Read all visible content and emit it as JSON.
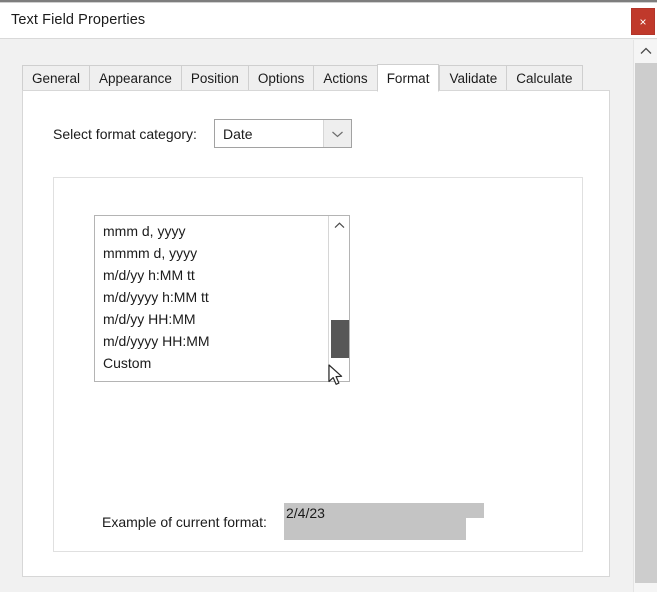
{
  "window": {
    "title": "Text Field Properties",
    "close_label": "×",
    "close_icon": "close-icon",
    "accent_close_color": "#c0392b"
  },
  "tabs": [
    {
      "label": "General",
      "active": false
    },
    {
      "label": "Appearance",
      "active": false
    },
    {
      "label": "Position",
      "active": false
    },
    {
      "label": "Options",
      "active": false
    },
    {
      "label": "Actions",
      "active": false
    },
    {
      "label": "Format",
      "active": true
    },
    {
      "label": "Validate",
      "active": false
    },
    {
      "label": "Calculate",
      "active": false
    }
  ],
  "format_tab": {
    "category": {
      "label": "Select format category:",
      "value": "Date",
      "arrow_icon": "chevron-down-icon"
    },
    "format_list": {
      "items": [
        "mmm d, yyyy",
        "mmmm d, yyyy",
        "m/d/yy h:MM tt",
        "m/d/yyyy h:MM tt",
        "m/d/yy HH:MM",
        "m/d/yyyy HH:MM",
        "Custom"
      ],
      "scroll_up_icon": "chevron-up-icon",
      "thumb_color": "#575757"
    },
    "example": {
      "label": "Example of current format:",
      "value": "2/4/23"
    }
  },
  "page_scrollbar": {
    "scroll_up_icon": "chevron-up-icon",
    "thumb_color": "#cdcdcd"
  },
  "cursor": {
    "icon": "mouse-pointer-icon"
  }
}
